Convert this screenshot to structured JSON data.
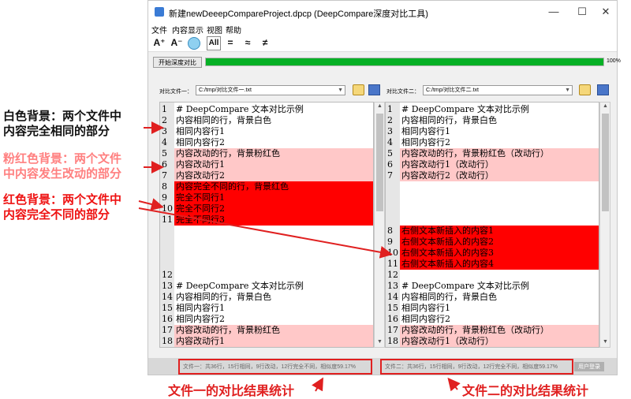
{
  "window": {
    "title": "新建newDeeepCompareProject.dpcp  (DeepCompare深度对比工具)",
    "controls": {
      "minimize": "—",
      "maximize": "☐",
      "close": "✕"
    }
  },
  "menu": [
    "文件",
    "内容显示",
    "视图",
    "帮助"
  ],
  "toolbar": {
    "font_up": "A⁺",
    "font_down": "A⁻",
    "all": "All",
    "equal": "=",
    "approx": "≈",
    "notequal": "≠"
  },
  "compare": {
    "start_label": "开始深度对比",
    "progress": 100,
    "progress_label": "100%"
  },
  "file1": {
    "label": "对比文件一：",
    "path": "C:/tmp/对比文件一.txt"
  },
  "file2": {
    "label": "对比文件二：",
    "path": "C:/tmp/对比文件二.txt"
  },
  "colors": {
    "same": "#ffffff",
    "changed": "#ffc8c8",
    "different": "#ff0000",
    "progress": "#06b025",
    "annotation_red": "#e02020"
  },
  "left_lines": [
    {
      "n": "1",
      "t": "# DeepCompare 文本对比示例",
      "type": "same"
    },
    {
      "n": "2",
      "t": "内容相同的行，背景白色",
      "type": "same"
    },
    {
      "n": "3",
      "t": "相同内容行1",
      "type": "same"
    },
    {
      "n": "4",
      "t": "相同内容行2",
      "type": "same"
    },
    {
      "n": "5",
      "t": "内容改动的行，背景粉红色",
      "type": "changed"
    },
    {
      "n": "6",
      "t": "内容改动行1",
      "type": "changed"
    },
    {
      "n": "7",
      "t": "内容改动行2",
      "type": "changed"
    },
    {
      "n": "8",
      "t": "内容完全不同的行，背景红色",
      "type": "different"
    },
    {
      "n": "9",
      "t": "完全不同行1",
      "type": "different"
    },
    {
      "n": "10",
      "t": "完全不同行2",
      "type": "different"
    },
    {
      "n": "11",
      "t": "完全不同行3",
      "type": "different"
    },
    {
      "n": "",
      "t": "",
      "type": "blank"
    },
    {
      "n": "",
      "t": "",
      "type": "blank"
    },
    {
      "n": "",
      "t": "",
      "type": "blank"
    },
    {
      "n": "",
      "t": "",
      "type": "blank"
    },
    {
      "n": "12",
      "t": "",
      "type": "same"
    },
    {
      "n": "13",
      "t": "# DeepCompare 文本对比示例",
      "type": "same"
    },
    {
      "n": "14",
      "t": "内容相同的行，背景白色",
      "type": "same"
    },
    {
      "n": "15",
      "t": "相同内容行1",
      "type": "same"
    },
    {
      "n": "16",
      "t": "相同内容行2",
      "type": "same"
    },
    {
      "n": "17",
      "t": "内容改动的行，背景粉红色",
      "type": "changed"
    },
    {
      "n": "18",
      "t": "内容改动行1",
      "type": "changed"
    }
  ],
  "right_lines": [
    {
      "n": "1",
      "t": "# DeepCompare 文本对比示例",
      "type": "same"
    },
    {
      "n": "2",
      "t": "内容相同的行，背景白色",
      "type": "same"
    },
    {
      "n": "3",
      "t": "相同内容行1",
      "type": "same"
    },
    {
      "n": "4",
      "t": "相同内容行2",
      "type": "same"
    },
    {
      "n": "5",
      "t": "内容改动的行，背景粉红色（改动行）",
      "type": "changed"
    },
    {
      "n": "6",
      "t": "内容改动行1（改动行）",
      "type": "changed"
    },
    {
      "n": "7",
      "t": "内容改动行2（改动行）",
      "type": "changed"
    },
    {
      "n": "",
      "t": "",
      "type": "blank"
    },
    {
      "n": "",
      "t": "",
      "type": "blank"
    },
    {
      "n": "",
      "t": "",
      "type": "blank"
    },
    {
      "n": "",
      "t": "",
      "type": "blank"
    },
    {
      "n": "8",
      "t": "右侧文本新插入的内容1",
      "type": "different"
    },
    {
      "n": "9",
      "t": "右侧文本新插入的内容2",
      "type": "different"
    },
    {
      "n": "10",
      "t": "右侧文本新插入的内容3",
      "type": "different"
    },
    {
      "n": "11",
      "t": "右侧文本新插入的内容4",
      "type": "different"
    },
    {
      "n": "12",
      "t": "",
      "type": "same"
    },
    {
      "n": "13",
      "t": "# DeepCompare 文本对比示例",
      "type": "same"
    },
    {
      "n": "14",
      "t": "内容相同的行，背景白色",
      "type": "same"
    },
    {
      "n": "15",
      "t": "相同内容行1",
      "type": "same"
    },
    {
      "n": "16",
      "t": "相同内容行2",
      "type": "same"
    },
    {
      "n": "17",
      "t": "内容改动的行，背景粉红色（改动行）",
      "type": "changed"
    },
    {
      "n": "18",
      "t": "内容改动行1（改动行）",
      "type": "changed"
    }
  ],
  "status": {
    "left": "文件一：共36行，15行相同，9行改动，12行完全不同，相似度59.17%",
    "right": "文件二：共36行，15行相同，9行改动，12行完全不同，相似度59.17%",
    "user": "用户登录"
  },
  "annotations": {
    "white_bg": [
      "白色背景：两个文件中",
      "内容完全相同的部分"
    ],
    "pink_bg": [
      "粉红色背景：两个文件",
      "中内容发生改动的部分"
    ],
    "red_bg": [
      "红色背景：两个文件中",
      "内容完全不同的部分"
    ],
    "file1_stats": "文件一的对比结果统计",
    "file2_stats": "文件二的对比结果统计"
  }
}
